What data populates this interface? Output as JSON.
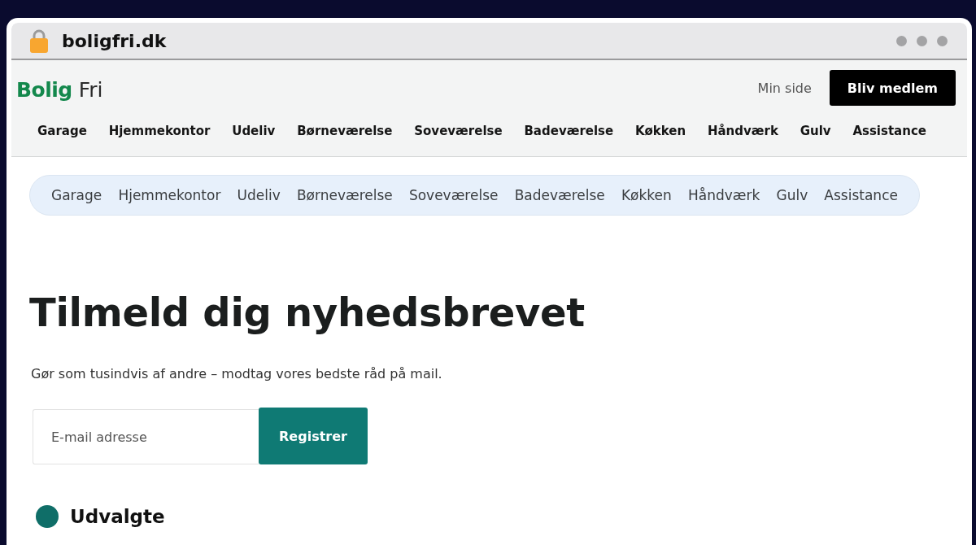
{
  "browser": {
    "address": "boligfri.dk"
  },
  "header": {
    "logo": {
      "primary": "Bolig",
      "secondary": "Fri"
    },
    "account_link": "Min side",
    "join_button": "Bliv medlem",
    "nav": [
      "Garage",
      "Hjemmekontor",
      "Udeliv",
      "Børneværelse",
      "Soveværelse",
      "Badeværelse",
      "Køkken",
      "Håndværk",
      "Gulv",
      "Assistance"
    ]
  },
  "category_bar": [
    "Garage",
    "Hjemmekontor",
    "Udeliv",
    "Børneværelse",
    "Soveværelse",
    "Badeværelse",
    "Køkken",
    "Håndværk",
    "Gulv",
    "Assistance"
  ],
  "newsletter": {
    "title": "Tilmeld dig nyhedsbrevet",
    "text": "Gør som tusindvis af andre – modtag vores bedste råd på mail.",
    "email_field": {
      "placeholder": "E-mail adresse"
    },
    "submit_button": "Registrer"
  },
  "section": {
    "title": "Udvalgte"
  }
}
